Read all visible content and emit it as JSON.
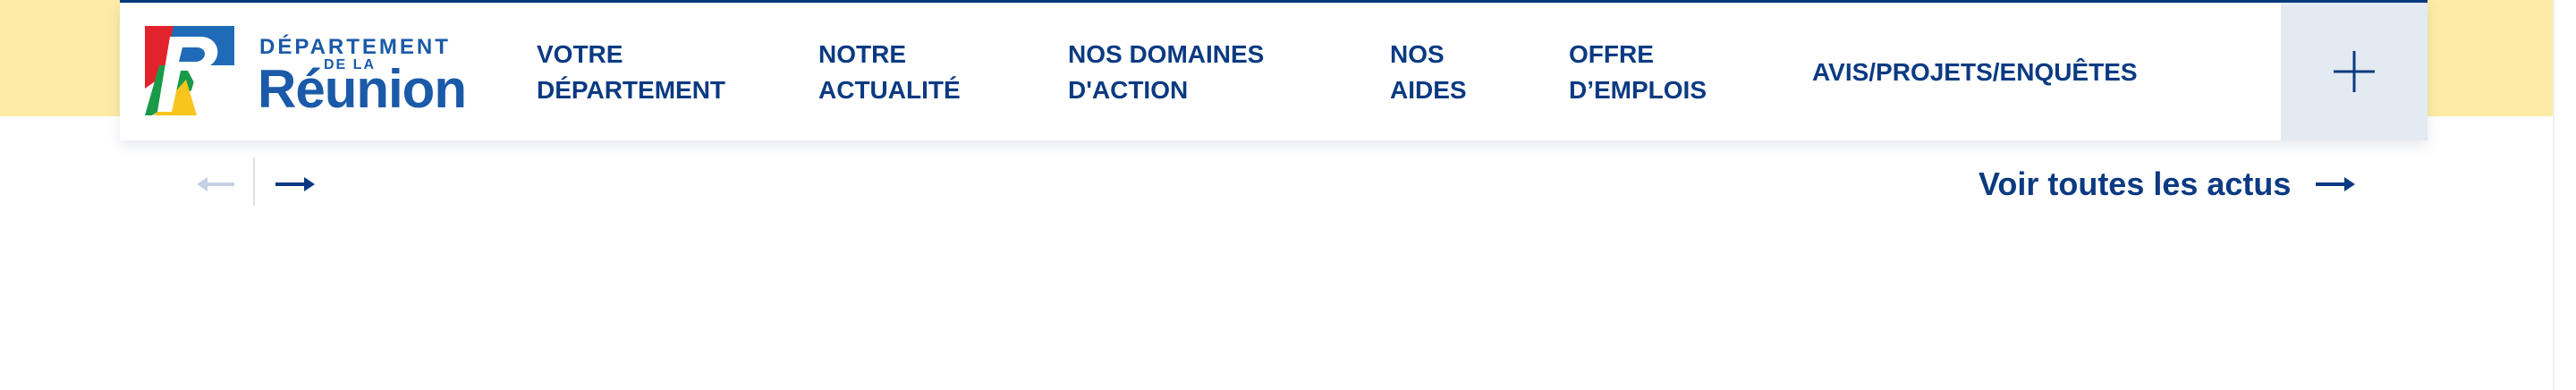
{
  "logo": {
    "line1": "DÉPARTEMENT",
    "line2": "DE LA",
    "line3": "Réunion"
  },
  "nav": {
    "items": [
      {
        "line1": "VOTRE",
        "line2": "DÉPARTEMENT"
      },
      {
        "line1": "NOTRE",
        "line2": "ACTUALITÉ"
      },
      {
        "line1": "NOS DOMAINES",
        "line2": "D'ACTION"
      },
      {
        "line1": "NOS",
        "line2": "AIDES"
      },
      {
        "line1": "OFFRE",
        "line2": "D’EMPLOIS"
      },
      {
        "line1": "AVIS/PROJETS/ENQUÊTES",
        "line2": ""
      }
    ]
  },
  "menu": {
    "plus_icon": "plus-icon"
  },
  "carousel": {
    "prev_icon": "arrow-left-icon",
    "next_icon": "arrow-right-icon",
    "see_all_label": "Voir toutes les actus",
    "see_all_icon": "arrow-right-icon"
  },
  "colors": {
    "brand_blue": "#0b3a82",
    "band_yellow": "#fdeba6",
    "menu_bg": "#e4eaf2",
    "disabled_arrow": "#c5d1e3"
  }
}
